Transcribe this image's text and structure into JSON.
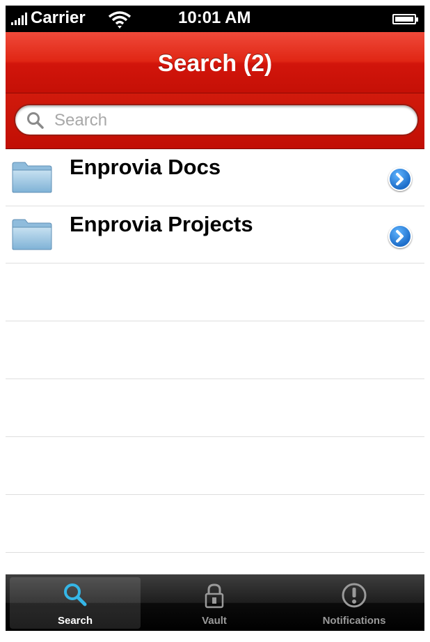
{
  "status_bar": {
    "carrier": "Carrier",
    "time": "10:01 AM"
  },
  "nav_bar": {
    "title": "Search (2)"
  },
  "search": {
    "placeholder": "Search",
    "value": ""
  },
  "results": [
    {
      "label": "Enprovia Docs",
      "icon": "folder-icon"
    },
    {
      "label": "Enprovia Projects",
      "icon": "folder-icon"
    }
  ],
  "tab_bar": {
    "selected": "Search",
    "tabs": [
      {
        "label": "Search",
        "icon": "magnifier-icon"
      },
      {
        "label": "Vault",
        "icon": "lock-icon"
      },
      {
        "label": "Notifications",
        "icon": "exclamation-icon"
      }
    ]
  },
  "colors": {
    "accent": "#d2150b",
    "disclosure": "#1e6ec9",
    "search_highlight": "#35b6e6"
  }
}
